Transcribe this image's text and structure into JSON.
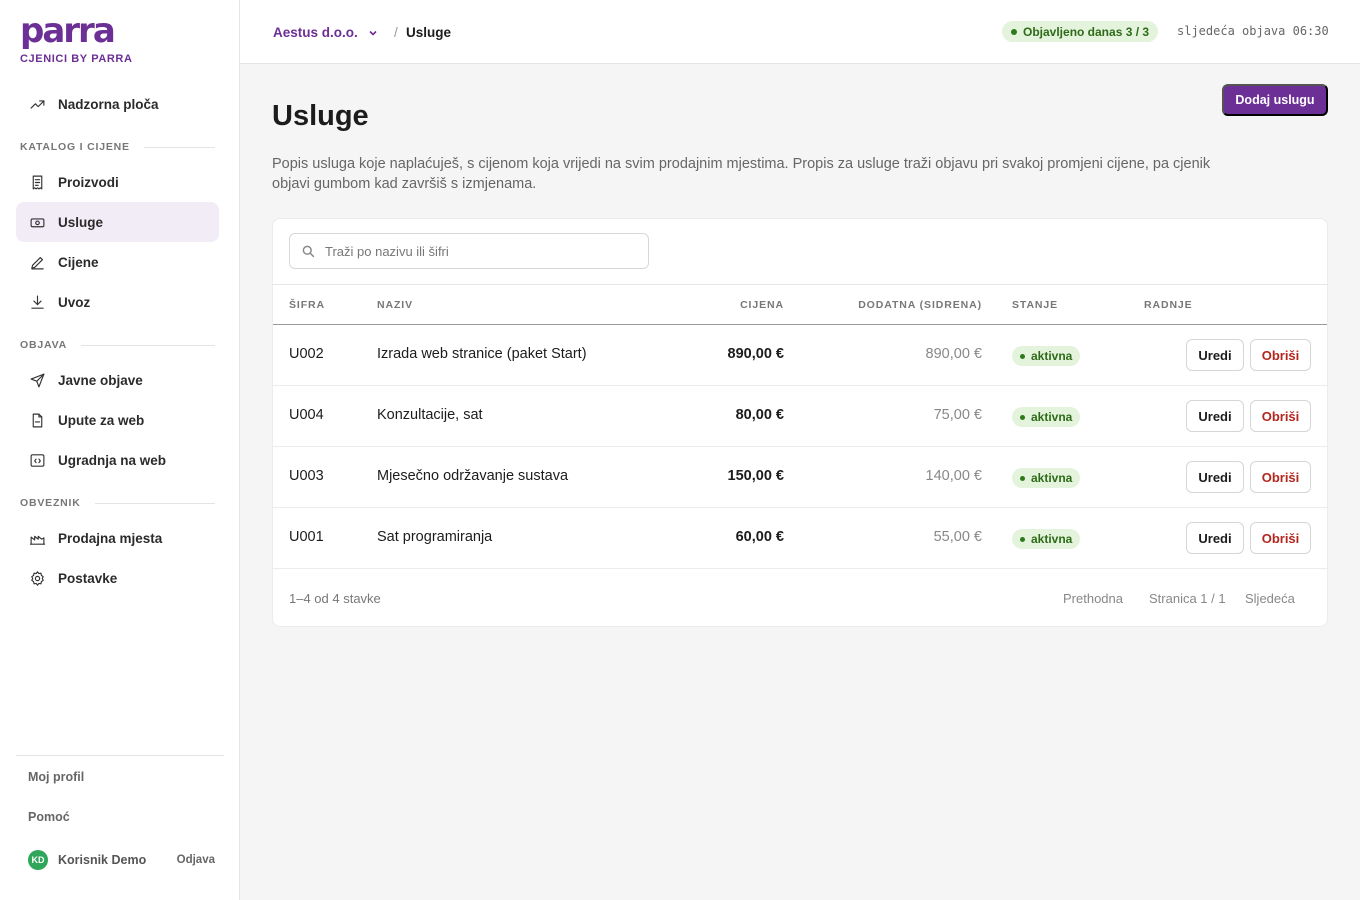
{
  "brand": {
    "logo": "parra",
    "subtitle": "CJENICI BY PARRA"
  },
  "sidebar": {
    "dashboard": "Nadzorna ploča",
    "sections": [
      "KATALOG I CIJENE",
      "OBJAVA",
      "OBVEZNIK"
    ],
    "items": [
      {
        "label": "Proizvodi",
        "icon": "receipt-icon"
      },
      {
        "label": "Usluge",
        "icon": "banknote-icon",
        "active": true
      },
      {
        "label": "Cijene",
        "icon": "pencil-icon"
      },
      {
        "label": "Uvoz",
        "icon": "download-icon"
      },
      {
        "label": "Javne objave",
        "icon": "send-icon"
      },
      {
        "label": "Upute za web",
        "icon": "file-icon"
      },
      {
        "label": "Ugradnja na web",
        "icon": "code-icon"
      },
      {
        "label": "Prodajna mjesta",
        "icon": "store-icon"
      },
      {
        "label": "Postavke",
        "icon": "gear-icon"
      }
    ],
    "footer": {
      "profile": "Moj profil",
      "help": "Pomoć",
      "user_initials": "KD",
      "user_name": "Korisnik Demo",
      "logout": "Odjava"
    }
  },
  "topbar": {
    "company": "Aestus d.o.o.",
    "separator": "/",
    "current": "Usluge",
    "published_badge": "Objavljeno danas 3 / 3",
    "next_publish": "sljedeća objava 06:30"
  },
  "main": {
    "title": "Usluge",
    "description": "Popis usluga koje naplaćuješ, s cijenom koja vrijedi na svim prodajnim mjestima. Propis za usluge traži objavu pri svakoj promjeni cijene, pa cjenik objavi gumbom kad završiš s izmjenama.",
    "add_button": "Dodaj uslugu",
    "search_placeholder": "Traži po nazivu ili šifri",
    "columns": {
      "code": "ŠIFRA",
      "name": "NAZIV",
      "price": "CIJENA",
      "anchor": "DODATNA (SIDRENA)",
      "status": "STANJE",
      "actions": "RADNJE"
    },
    "rows": [
      {
        "code": "U002",
        "name": "Izrada web stranice (paket Start)",
        "price": "890,00 €",
        "anchor": "890,00 €",
        "status": "aktivna"
      },
      {
        "code": "U004",
        "name": "Konzultacije, sat",
        "price": "80,00 €",
        "anchor": "75,00 €",
        "status": "aktivna"
      },
      {
        "code": "U003",
        "name": "Mjesečno održavanje sustava",
        "price": "150,00 €",
        "anchor": "140,00 €",
        "status": "aktivna"
      },
      {
        "code": "U001",
        "name": "Sat programiranja",
        "price": "60,00 €",
        "anchor": "55,00 €",
        "status": "aktivna"
      }
    ],
    "edit_label": "Uredi",
    "delete_label": "Obriši",
    "footer": {
      "count": "1–4 od 4 stavke",
      "prev": "Prethodna",
      "page": "Stranica 1 / 1",
      "next": "Sljedeća"
    }
  },
  "colors": {
    "brand": "#6b2f95",
    "active_bg": "#f2ecf6",
    "status_bg": "#e4f3dc",
    "status_fg": "#2d6b19",
    "danger": "#b3261e"
  }
}
